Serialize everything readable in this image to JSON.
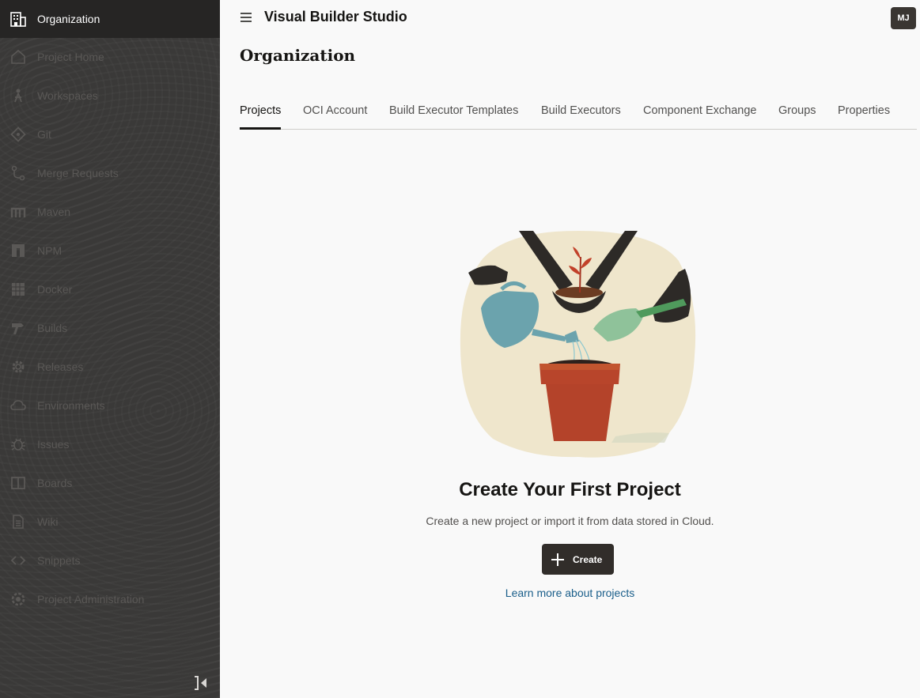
{
  "sidebar": {
    "items": [
      {
        "label": "Organization",
        "icon": "building-icon",
        "active": true
      },
      {
        "label": "Project Home",
        "icon": "home-icon"
      },
      {
        "label": "Workspaces",
        "icon": "workspaces-icon"
      },
      {
        "label": "Git",
        "icon": "git-icon"
      },
      {
        "label": "Merge Requests",
        "icon": "merge-request-icon"
      },
      {
        "label": "Maven",
        "icon": "maven-icon"
      },
      {
        "label": "NPM",
        "icon": "npm-icon"
      },
      {
        "label": "Docker",
        "icon": "docker-icon"
      },
      {
        "label": "Builds",
        "icon": "hammer-icon"
      },
      {
        "label": "Releases",
        "icon": "gear-icon"
      },
      {
        "label": "Environments",
        "icon": "cloud-icon"
      },
      {
        "label": "Issues",
        "icon": "bug-icon"
      },
      {
        "label": "Boards",
        "icon": "board-icon"
      },
      {
        "label": "Wiki",
        "icon": "document-icon"
      },
      {
        "label": "Snippets",
        "icon": "code-icon"
      },
      {
        "label": "Project Administration",
        "icon": "admin-gear-icon"
      }
    ],
    "collapse_icon": "collapse-sidebar-icon"
  },
  "header": {
    "app_title": "Visual Builder Studio",
    "avatar_initials": "MJ"
  },
  "page": {
    "title": "Organization"
  },
  "tabs": [
    {
      "label": "Projects",
      "active": true
    },
    {
      "label": "OCI Account"
    },
    {
      "label": "Build Executor Templates"
    },
    {
      "label": "Build Executors"
    },
    {
      "label": "Component Exchange"
    },
    {
      "label": "Groups"
    },
    {
      "label": "Properties"
    }
  ],
  "empty_state": {
    "title": "Create Your First Project",
    "description": "Create a new project or import it from data stored in Cloud.",
    "create_label": "Create",
    "learn_more": "Learn more about projects"
  },
  "colors": {
    "sidebar_bg": "#3a3938",
    "sidebar_active_bg": "#262524",
    "button_bg": "#312d2a",
    "link": "#1a5e8a"
  }
}
